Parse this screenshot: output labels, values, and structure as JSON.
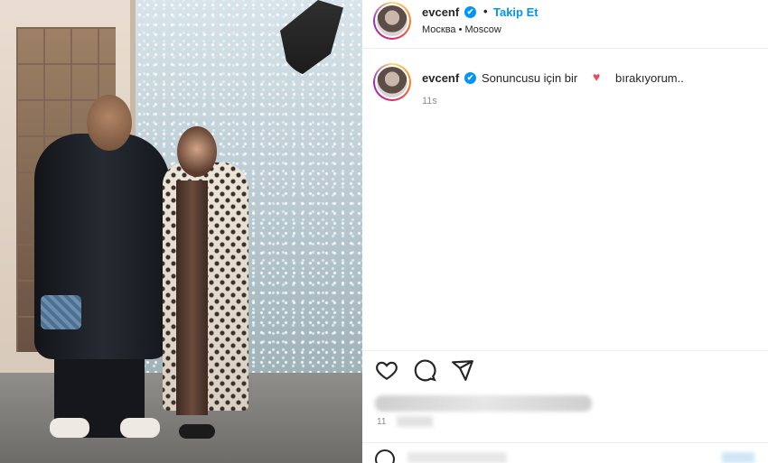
{
  "post": {
    "username": "evcenf",
    "verified_mark": "✔",
    "dot": "•",
    "follow_label": "Takip Et",
    "location": "Москва • Moscow"
  },
  "caption": {
    "username": "evcenf",
    "text_before": "Sonuncusu için bir",
    "heart": "♥",
    "text_after": "bırakıyorum..",
    "time": "11s"
  },
  "footer": {
    "date": "11"
  },
  "icons": [
    "heart-icon",
    "comment-icon",
    "share-icon",
    "emoji-icon"
  ],
  "colors": {
    "accent": "#0095f6",
    "heart": "#ed4956",
    "text": "#262626",
    "muted": "#8e8e8e"
  }
}
